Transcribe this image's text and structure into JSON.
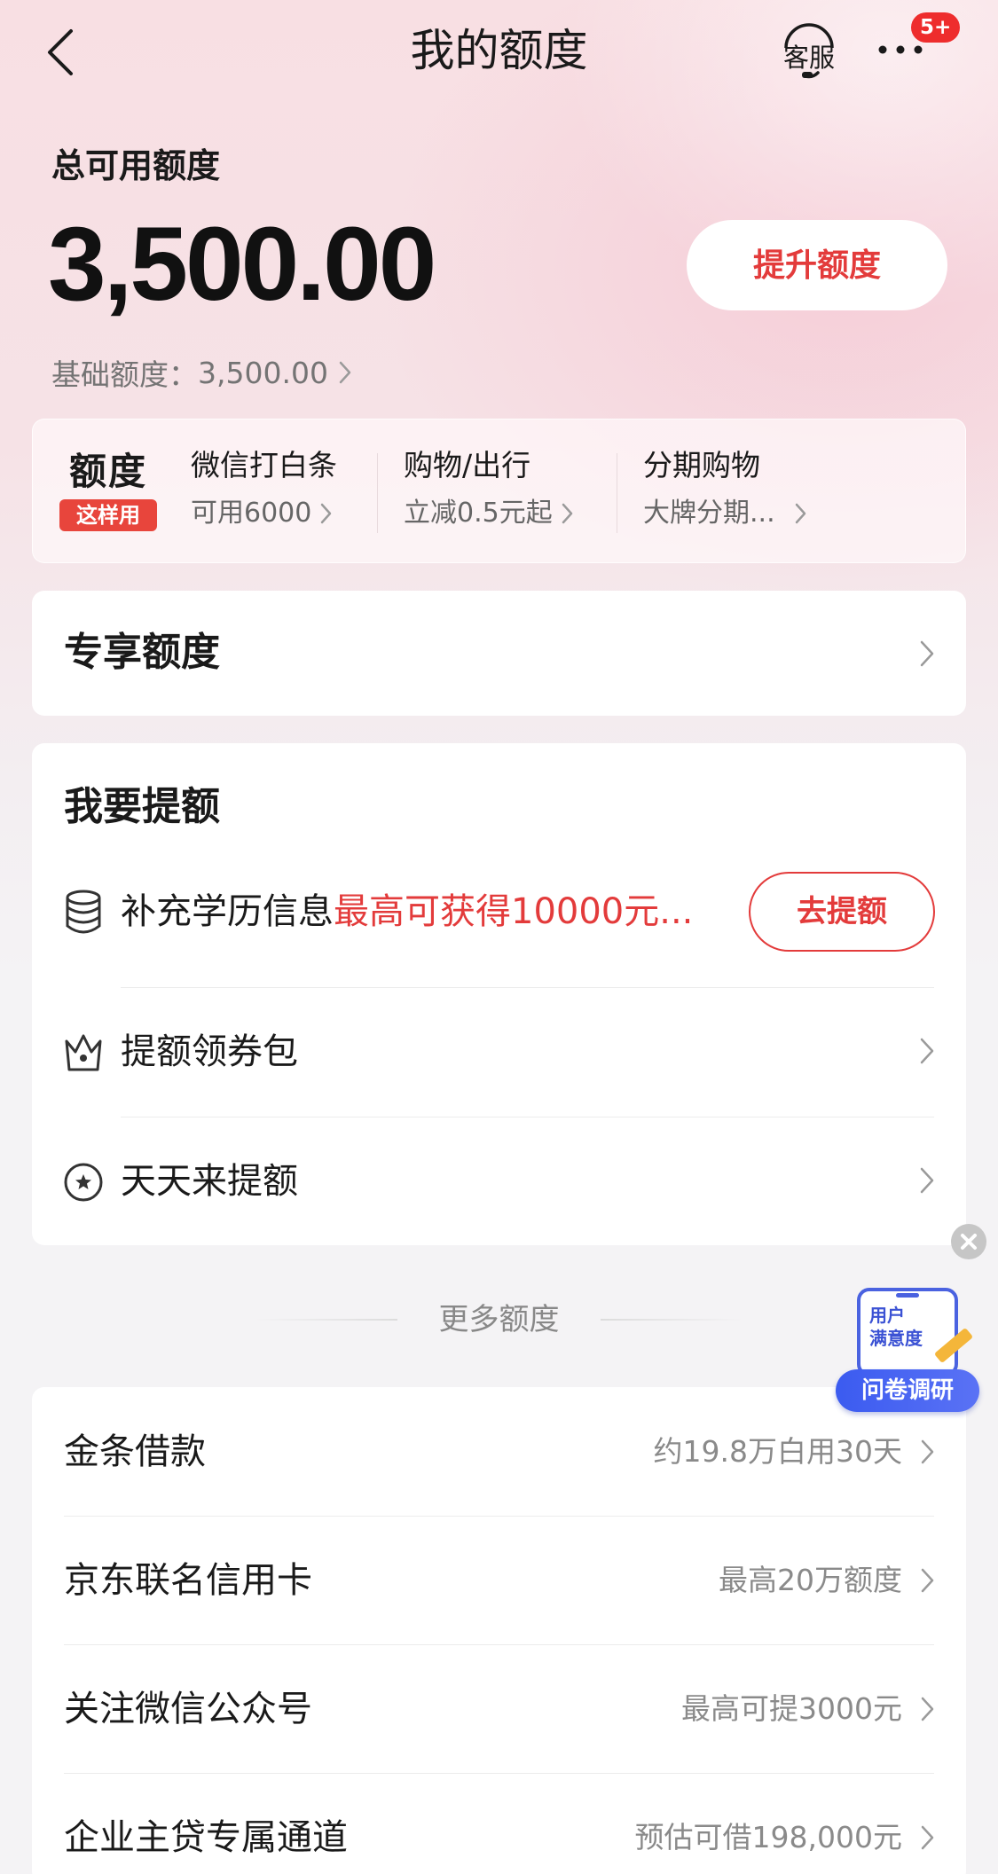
{
  "nav": {
    "title": "我的额度",
    "service_label": "客服",
    "badge": "5+"
  },
  "balance": {
    "total_label": "总可用额度",
    "total_amount": "3,500.00",
    "raise_button": "提升额度",
    "base_label": "基础额度：",
    "base_amount": "3,500.00"
  },
  "promo": {
    "logo_title": "额度",
    "logo_tag": "这样用",
    "items": [
      {
        "title": "微信打白条",
        "sub": "可用6000"
      },
      {
        "title": "购物/出行",
        "sub": "立减0.5元起"
      },
      {
        "title": "分期购物",
        "sub": "大牌分期..."
      }
    ]
  },
  "exclusive": {
    "title": "专享额度"
  },
  "raise": {
    "title": "我要提额",
    "rows": [
      {
        "label": "补充学历信息",
        "highlight": "最高可获得10000元...",
        "icon": "database-icon",
        "button": "去提额"
      },
      {
        "label": "提额领券包",
        "icon": "crown-icon"
      },
      {
        "label": "天天来提额",
        "icon": "star-circle-icon"
      }
    ]
  },
  "more": {
    "divider": "更多额度",
    "rows": [
      {
        "label": "金条借款",
        "value": "约19.8万白用30天"
      },
      {
        "label": "京东联名信用卡",
        "value": "最高20万额度"
      },
      {
        "label": "关注微信公众号",
        "value": "最高可提3000元"
      },
      {
        "label": "企业主贷专属通道",
        "value": "预估可借198,000元"
      }
    ]
  },
  "survey": {
    "card_text_1": "用户",
    "card_text_2": "满意度",
    "tag": "问卷调研"
  },
  "colors": {
    "accent": "#e33b3b",
    "survey_blue": "#4a62e0",
    "text_primary": "#1a1a1a",
    "text_secondary": "#8a8a8a"
  }
}
